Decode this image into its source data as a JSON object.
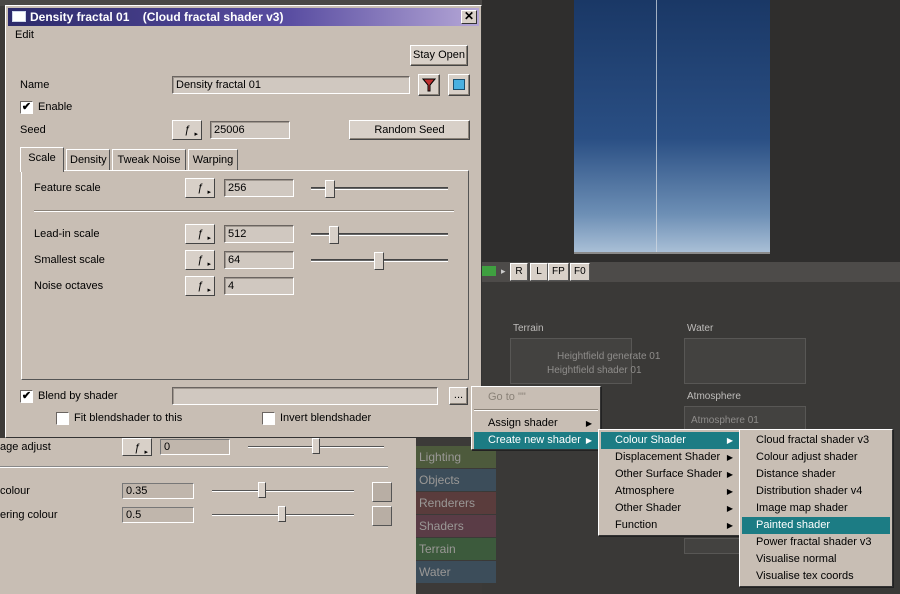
{
  "dialog": {
    "title": "Density fractal 01",
    "subtitle": "(Cloud fractal shader v3)",
    "menu_edit": "Edit",
    "stay_open": "Stay Open",
    "name_label": "Name",
    "name_value": "Density fractal 01",
    "enable_label": "Enable",
    "seed_label": "Seed",
    "seed_value": "25006",
    "random_seed": "Random Seed",
    "fn_glyph": "ƒ",
    "fn_arrow": "▸",
    "tabs": [
      "Scale",
      "Density",
      "Tweak Noise",
      "Warping"
    ],
    "feature_scale_label": "Feature scale",
    "feature_scale_value": "256",
    "leadin_scale_label": "Lead-in scale",
    "leadin_scale_value": "512",
    "smallest_scale_label": "Smallest scale",
    "smallest_scale_value": "64",
    "noise_octaves_label": "Noise octaves",
    "noise_octaves_value": "4",
    "blend_label": "Blend by shader",
    "blend_value": "",
    "browse": "...",
    "fit_blend_label": "Fit blendshader to this",
    "invert_blend_label": "Invert blendshader",
    "checkmark": "✔",
    "close": "✕"
  },
  "menu1": {
    "items": [
      "Go to \"\"",
      "Assign shader",
      "Create new shader"
    ]
  },
  "menu2": {
    "items": [
      "Colour Shader",
      "Displacement Shader",
      "Other Surface Shader",
      "Atmosphere",
      "Other Shader",
      "Function"
    ]
  },
  "menu3": {
    "items": [
      "Cloud fractal shader v3",
      "Colour adjust shader",
      "Distance shader",
      "Distribution shader v4",
      "Image map shader",
      "Painted shader",
      "Power fractal shader v3",
      "Visualise normal",
      "Visualise tex coords"
    ]
  },
  "submenu_arrow": "▶",
  "toolbar": {
    "buttons": [
      "R",
      "L",
      "FP",
      "F0"
    ],
    "arrow": "▸"
  },
  "nodes": {
    "terrain_label": "Terrain",
    "terrain_inner1": "Heightfield generate 01",
    "terrain_inner2": "Heightfield shader 01",
    "water_label": "Water",
    "atmosphere_label": "Atmosphere",
    "atmosphere_inner": "Atmosphere 01"
  },
  "categories": [
    "Lighting",
    "Objects",
    "Renderers",
    "Shaders",
    "Terrain",
    "Water"
  ],
  "category_colors": [
    "#4d5a3c",
    "#3c4d5a",
    "#5a3c3c",
    "#5a3c46",
    "#3c5a3c",
    "#3c4d5a"
  ],
  "left_panel": {
    "image_adjust_label": "age adjust",
    "image_adjust_value": "0",
    "colour_label": "colour",
    "colour_value": "0.35",
    "tering_colour_label": "ering colour",
    "tering_colour_value": "0.5"
  }
}
